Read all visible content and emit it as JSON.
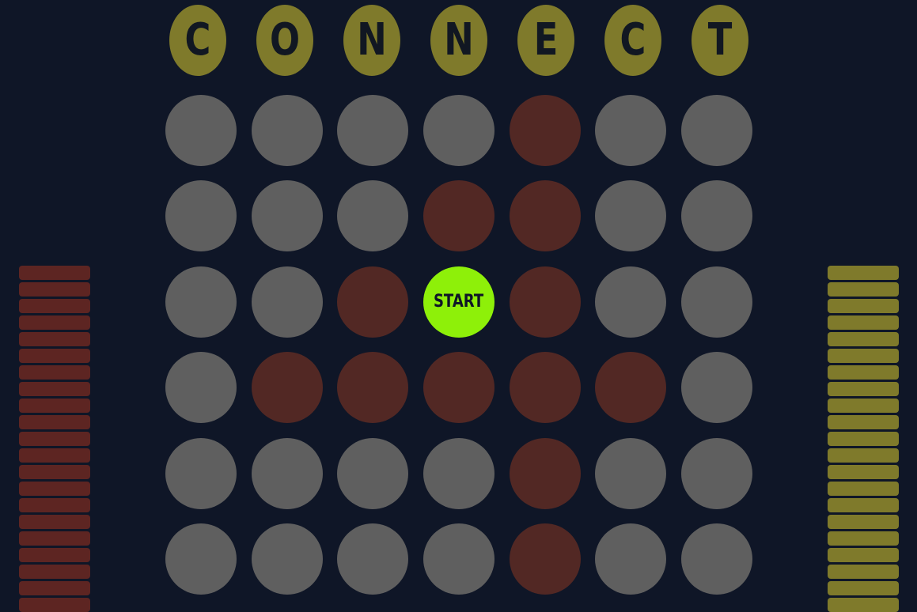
{
  "title": {
    "letters": [
      "C",
      "O",
      "N",
      "N",
      "E",
      "C",
      "T"
    ]
  },
  "board": {
    "rows": 6,
    "cols": 7,
    "grid": [
      [
        "empty",
        "empty",
        "empty",
        "empty",
        "red",
        "empty",
        "empty"
      ],
      [
        "empty",
        "empty",
        "empty",
        "red",
        "red",
        "empty",
        "empty"
      ],
      [
        "empty",
        "empty",
        "red",
        "start",
        "red",
        "empty",
        "empty"
      ],
      [
        "empty",
        "red",
        "red",
        "red",
        "red",
        "red",
        "empty"
      ],
      [
        "empty",
        "empty",
        "empty",
        "empty",
        "red",
        "empty",
        "empty"
      ],
      [
        "empty",
        "empty",
        "empty",
        "empty",
        "red",
        "empty",
        "empty"
      ]
    ],
    "start_label": "START"
  },
  "players": {
    "red": {
      "remaining_discs": 21
    },
    "yellow": {
      "remaining_discs": 21
    }
  },
  "colors": {
    "background": "#0f1627",
    "title_circle": "#7f7a2b",
    "empty_cell": "#5f5f5f",
    "red_disc": "#522824",
    "yellow_disc": "#7f7a2b",
    "start_button": "#8ef009"
  }
}
